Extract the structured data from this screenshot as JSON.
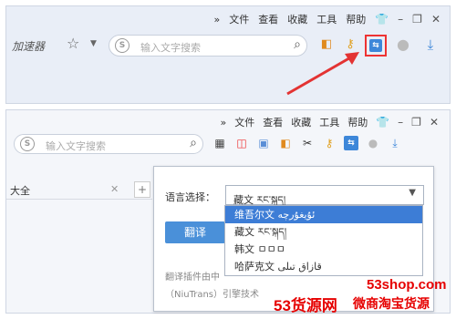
{
  "top_window": {
    "menu": [
      "»",
      "文件",
      "查看",
      "收藏",
      "工具",
      "帮助"
    ],
    "window_controls": [
      "👕",
      "–",
      "❐",
      "✕"
    ],
    "accelerator_label": "加速器",
    "search_placeholder": "输入文字搜索",
    "search_badge": "S"
  },
  "bottom_window": {
    "menu": [
      "»",
      "文件",
      "查看",
      "收藏",
      "工具",
      "帮助"
    ],
    "window_controls": [
      "👕",
      "–",
      "❐",
      "✕"
    ],
    "search_placeholder": "输入文字搜索",
    "search_badge": "S",
    "tab_label": "大全",
    "tab_close": "✕",
    "tab_new": "+"
  },
  "translate_popup": {
    "language_label": "语言选择：",
    "selected_language": "藏文 རང་སྐད།",
    "translate_button": "翻译",
    "footer_line1": "翻译插件由中",
    "footer_line2": "（NiuTrans）引擎技术",
    "options": [
      "维吾尔文 ئۇيغۇرچە",
      "藏文 རང་སྐད།",
      "韩文 ㅁㅁㅁ",
      "哈萨克文 قازاق تىلى"
    ],
    "highlighted_index": 0
  },
  "watermark": {
    "domain": "53shop.com",
    "brand": "53货源网",
    "sub": "微商淘宝货源"
  },
  "colors": {
    "accent": "#3d7dd6",
    "highlight_border": "#e33333",
    "watermark": "#e60000"
  }
}
